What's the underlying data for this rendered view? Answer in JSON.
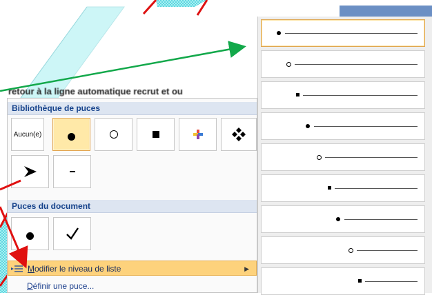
{
  "document": {
    "partial_text": "retour à la ligne automatique recrut et ou"
  },
  "bullet_menu": {
    "library_header": "Bibliothèque de puces",
    "library_items": [
      {
        "kind": "text",
        "text": "Aucun(e)",
        "icon": "none-text"
      },
      {
        "kind": "dot",
        "icon": "filled-circle-icon",
        "selected": true
      },
      {
        "kind": "ring",
        "icon": "hollow-circle-icon"
      },
      {
        "kind": "square",
        "icon": "filled-square-icon"
      },
      {
        "kind": "colorcross",
        "icon": "colored-cross-icon"
      },
      {
        "kind": "diamonds",
        "icon": "four-diamonds-icon"
      },
      {
        "kind": "arrow",
        "icon": "arrowhead-icon"
      },
      {
        "kind": "dash",
        "icon": "dash-icon"
      }
    ],
    "document_header": "Puces du document",
    "document_items": [
      {
        "kind": "dot",
        "icon": "filled-circle-icon"
      },
      {
        "kind": "check",
        "icon": "checkmark-icon"
      }
    ],
    "change_level": {
      "prefix": "",
      "accel": "M",
      "rest": "odifier le niveau de liste",
      "icon": "list-level-icon",
      "arrow": "▶"
    },
    "define_bullet": {
      "accel": "D",
      "rest": "éfinir une puce..."
    }
  },
  "list_levels": {
    "levels": [
      {
        "bullet": "dot",
        "selected": true
      },
      {
        "bullet": "ring"
      },
      {
        "bullet": "square"
      },
      {
        "bullet": "dot"
      },
      {
        "bullet": "ring"
      },
      {
        "bullet": "square"
      },
      {
        "bullet": "dot"
      },
      {
        "bullet": "ring"
      },
      {
        "bullet": "square"
      }
    ]
  },
  "annotations": {
    "green_arrow_color": "#12a84a",
    "red_arrow_color": "#e01010"
  }
}
